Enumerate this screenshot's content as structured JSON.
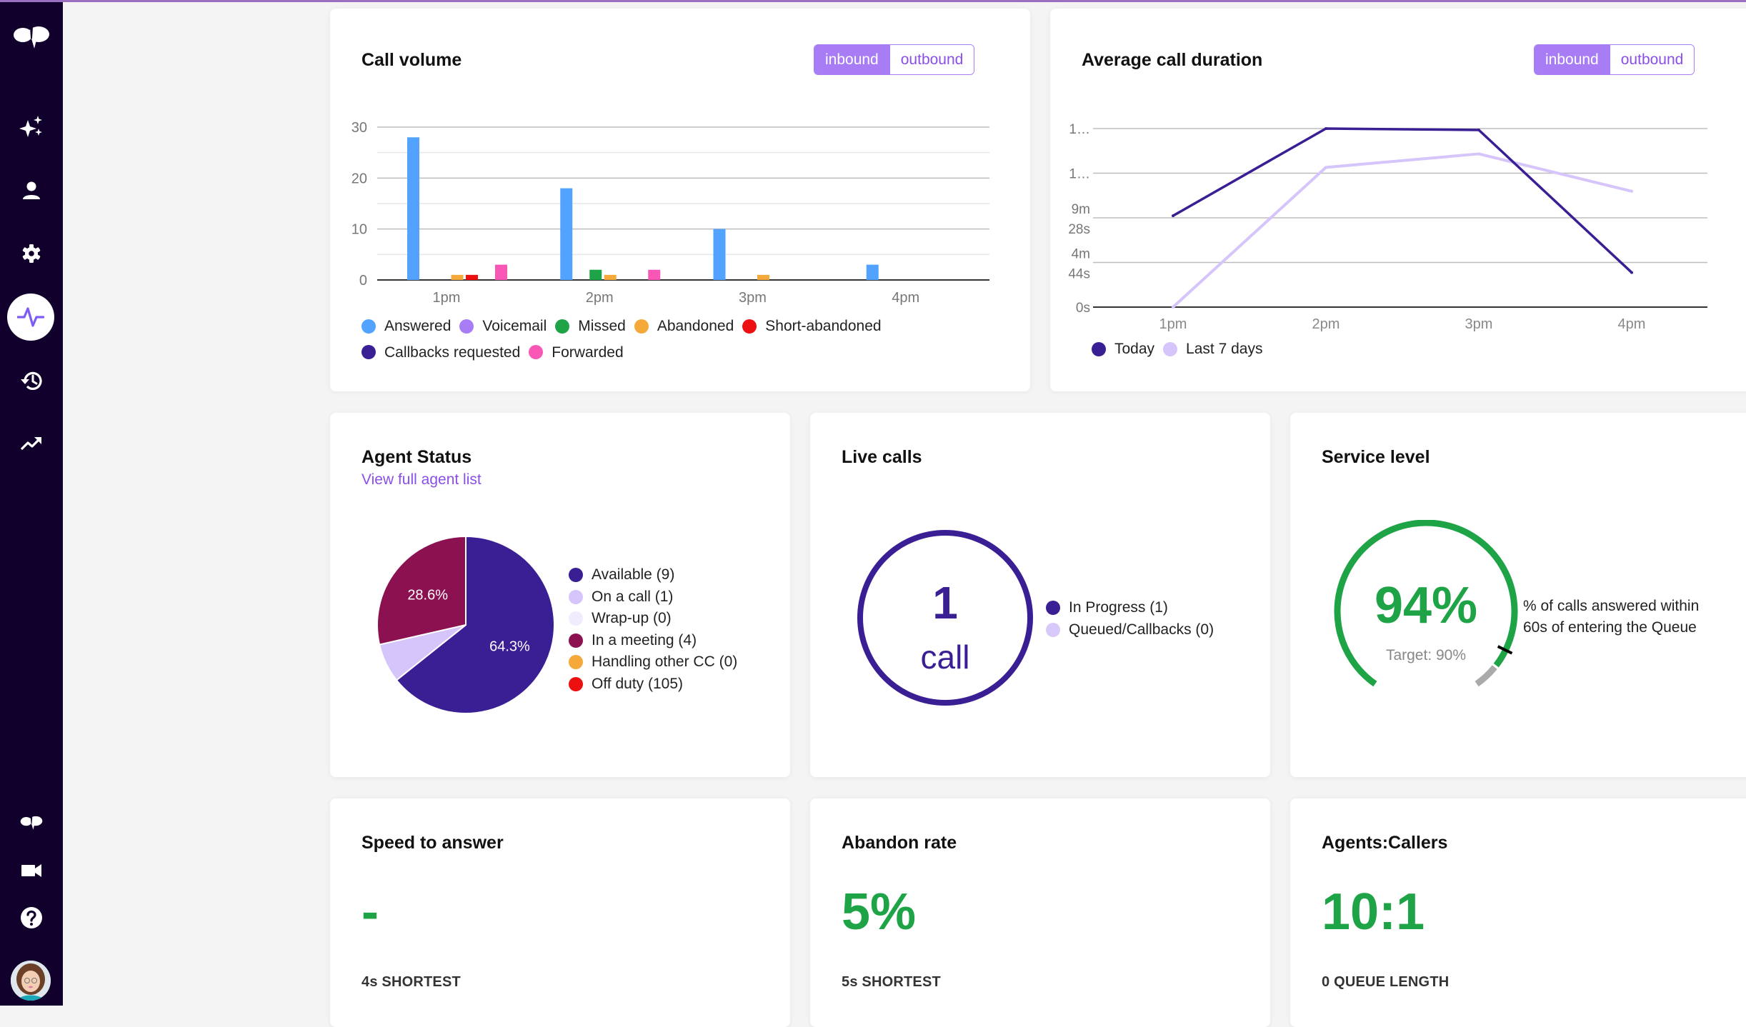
{
  "sidebar": {
    "top_items": [
      {
        "name": "logo",
        "label": "Dialpad"
      },
      {
        "name": "ai-sparkle",
        "label": "AI"
      },
      {
        "name": "contacts",
        "label": "Contacts"
      },
      {
        "name": "settings",
        "label": "Settings"
      },
      {
        "name": "live-dashboard",
        "label": "Live dashboard",
        "active": true
      },
      {
        "name": "history",
        "label": "History"
      },
      {
        "name": "analytics",
        "label": "Analytics"
      }
    ],
    "bottom_items": [
      {
        "name": "dialpad-app",
        "label": "Dialpad"
      },
      {
        "name": "meetings-video",
        "label": "Meetings"
      },
      {
        "name": "help",
        "label": "Help"
      },
      {
        "name": "user-avatar",
        "label": "Profile"
      }
    ],
    "active_color": "#7c5cf5"
  },
  "call_volume": {
    "title": "Call volume",
    "toggle": {
      "inbound": "inbound",
      "outbound": "outbound",
      "selected": "inbound"
    }
  },
  "avg_duration": {
    "title": "Average call duration",
    "toggle": {
      "inbound": "inbound",
      "outbound": "outbound",
      "selected": "inbound"
    }
  },
  "agent_status": {
    "title": "Agent Status",
    "link": "View full agent list"
  },
  "live_calls": {
    "title": "Live calls",
    "count": "1",
    "unit": "call",
    "legend": [
      {
        "label": "In Progress (1)",
        "color": "#3a1e94",
        "value": 1
      },
      {
        "label": "Queued/Callbacks (0)",
        "color": "#d9c9fb",
        "value": 0
      }
    ]
  },
  "service_level": {
    "title": "Service level",
    "value": "94%",
    "value_pct": 94,
    "target": "Target: 90%",
    "target_pct": 90,
    "description_line1": "% of calls answered within",
    "description_line2": "60s of entering the Queue",
    "colors": {
      "fill": "#1ea446",
      "rest": "#aaaaaa",
      "marker": "#000000"
    }
  },
  "speed_to_answer": {
    "title": "Speed to answer",
    "value": "-",
    "caption": "4s SHORTEST"
  },
  "abandon_rate": {
    "title": "Abandon rate",
    "value": "5%",
    "caption": "5s SHORTEST"
  },
  "agents_callers": {
    "title": "Agents:Callers",
    "value": "10:1",
    "caption": "0 QUEUE LENGTH"
  },
  "chart_data": [
    {
      "id": "call-volume",
      "type": "bar",
      "title": "Call volume",
      "xlabel": "",
      "ylabel": "",
      "categories": [
        "1pm",
        "2pm",
        "3pm",
        "4pm"
      ],
      "ylim": [
        0,
        30
      ],
      "yticks": [
        0,
        10,
        20,
        30
      ],
      "grid": true,
      "legend_position": "bottom",
      "series": [
        {
          "name": "Answered",
          "color": "#52a2ff",
          "values": [
            28,
            18,
            10,
            3
          ]
        },
        {
          "name": "Voicemail",
          "color": "#a87cf5",
          "values": [
            0,
            0,
            0,
            0
          ]
        },
        {
          "name": "Missed",
          "color": "#1ea446",
          "values": [
            0,
            2,
            0,
            0
          ]
        },
        {
          "name": "Abandoned",
          "color": "#f6a93b",
          "values": [
            1,
            1,
            1,
            0
          ]
        },
        {
          "name": "Short-abandoned",
          "color": "#ec1010",
          "values": [
            1,
            0,
            0,
            0
          ]
        },
        {
          "name": "Callbacks requested",
          "color": "#3a1e94",
          "values": [
            0,
            0,
            0,
            0
          ]
        },
        {
          "name": "Forwarded",
          "color": "#f857b5",
          "values": [
            3,
            2,
            0,
            0
          ]
        }
      ]
    },
    {
      "id": "average-call-duration",
      "type": "line",
      "title": "Average call duration",
      "x": [
        "1pm",
        "2pm",
        "3pm",
        "4pm"
      ],
      "y_unit": "seconds",
      "ylim": [
        0,
        1136
      ],
      "yticks": [
        0,
        284,
        568,
        852,
        1136
      ],
      "ytick_labels": [
        "0s",
        "4m 44s",
        "9m 28s",
        "1…",
        "1…"
      ],
      "grid": true,
      "legend_position": "bottom-left",
      "series": [
        {
          "name": "Today",
          "color": "#3a1e94",
          "values": [
            581,
            1136,
            1127,
            220
          ]
        },
        {
          "name": "Last 7 days",
          "color": "#d6c5fb",
          "values": [
            0,
            889,
            975,
            737
          ]
        }
      ]
    },
    {
      "id": "agent-status",
      "type": "pie",
      "title": "Agent Status",
      "legend_position": "right",
      "slices": [
        {
          "name": "Available",
          "label": "Available (9)",
          "value": 9,
          "pct_label": "64.3%",
          "color": "#3a1e94"
        },
        {
          "name": "On a call",
          "label": "On a call (1)",
          "value": 1,
          "pct_label": "",
          "color": "#d6c5fb"
        },
        {
          "name": "Wrap-up",
          "label": "Wrap-up (0)",
          "value": 0,
          "pct_label": "",
          "color": "#f1ecfd"
        },
        {
          "name": "In a meeting",
          "label": "In a meeting (4)",
          "value": 4,
          "pct_label": "28.6%",
          "color": "#8c1150"
        },
        {
          "name": "Handling other CC",
          "label": "Handling other CC (0)",
          "value": 0,
          "pct_label": "",
          "color": "#f6a93b"
        },
        {
          "name": "Off duty",
          "label": "Off duty (105)",
          "value": 105,
          "pct_label": "",
          "color": "#ec1010",
          "excluded_from_pie": true
        }
      ]
    }
  ]
}
